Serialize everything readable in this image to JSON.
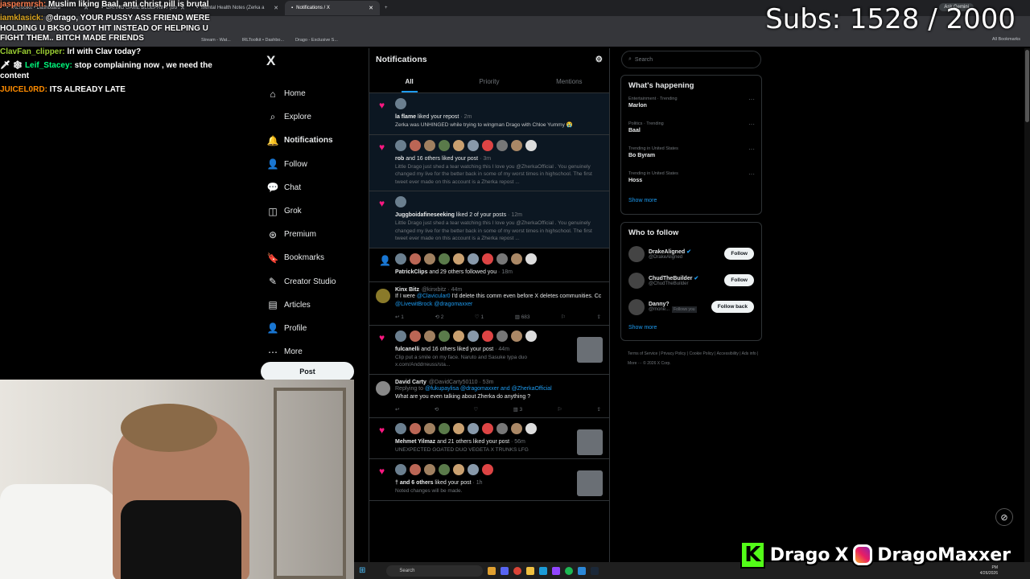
{
  "browser": {
    "tabs": [
      {
        "label": "IRLToolkit • Dashboard",
        "active": false
      },
      {
        "label": "DATING GAME BLUEPRINT (Bo",
        "active": false
      },
      {
        "label": "Mental Health Notes (Zerka a",
        "active": false
      },
      {
        "label": "Notifications / X",
        "active": true
      }
    ],
    "new_tab": "+",
    "bookmarks": [
      "Stream - Wat...",
      "IRLToolkit • Dashbo...",
      "Drago - Exclusive S..."
    ],
    "all_bookmarks": "All Bookmarks",
    "ask_gemini": "Ask Gemini"
  },
  "stream": {
    "subs": "Subs: 1528 / 2000",
    "chat": [
      {
        "user": "jaspermrsh:",
        "text": " Muslim liking Baal, anti christ pill is brutal",
        "color": "#ff7f50"
      },
      {
        "user": "iamklasick:",
        "text": " @drago, YOUR PUSSY ASS FRIEND WERE HOLDING U BKSO UGOT HIT INSTEAD OF HELPING U FIGHT THEM.. BITCH MADE FRIENDS",
        "color": "#daa520"
      },
      {
        "user": "ClavFan_clipper:",
        "text": " lrl with Clav today?",
        "color": "#9acd32"
      },
      {
        "user": "Leif_Stacey:",
        "text": " stop complaining now , we need the content",
        "color": "#00ff7f",
        "prefix": "🗡 ❄ "
      },
      {
        "user": "JUICEL0RD:",
        "text": " ITS ALREADY LATE",
        "color": "#ff8c00"
      }
    ],
    "brand": {
      "kick": "K",
      "kick_name": "Drago",
      "x_mark": "X",
      "ig_name": "DragoMaxxer"
    }
  },
  "nav": {
    "logo": "X",
    "items": [
      {
        "label": "Home",
        "icon": "⌂",
        "name": "home"
      },
      {
        "label": "Explore",
        "icon": "⌕",
        "name": "explore"
      },
      {
        "label": "Notifications",
        "icon": "🔔",
        "name": "notifications",
        "bold": true
      },
      {
        "label": "Follow",
        "icon": "👤",
        "name": "follow"
      },
      {
        "label": "Chat",
        "icon": "💬",
        "name": "chat"
      },
      {
        "label": "Grok",
        "icon": "◫",
        "name": "grok"
      },
      {
        "label": "Premium",
        "icon": "⊛",
        "name": "premium"
      },
      {
        "label": "Bookmarks",
        "icon": "🔖",
        "name": "bookmarks"
      },
      {
        "label": "Creator Studio",
        "icon": "✎",
        "name": "creator-studio"
      },
      {
        "label": "Articles",
        "icon": "▤",
        "name": "articles"
      },
      {
        "label": "Profile",
        "icon": "👤",
        "name": "profile"
      },
      {
        "label": "More",
        "icon": "⋯",
        "name": "more"
      }
    ],
    "post": "Post"
  },
  "feed": {
    "title": "Notifications",
    "tabs": [
      "All",
      "Priority",
      "Mentions"
    ],
    "notifications": [
      {
        "avatars": 1,
        "who": "la flame",
        "action": " liked your repost",
        "time": " · 2m",
        "text": "Zerka was UNHINGED while trying to wingman Drago with Chloe Yummy 😭",
        "white": true,
        "hl": true
      },
      {
        "avatars": 10,
        "who": "rob",
        "action": " and 16 others liked your post",
        "time": " · 3m",
        "text": "Little Drago just shed a tear watching this I love you @ZherkaOfficial . You genuinely changed my live for the better back in some of my worst times in highschool. The first tweet ever made on this account is a Zherka  repost ...",
        "hl": true
      },
      {
        "avatars": 1,
        "who": "Juggboidafineseeking",
        "action": " liked 2 of your posts",
        "time": " · 12m",
        "text": "Little Drago just shed a tear watching this I love you @ZherkaOfficial . You genuinely changed my live for the better back in some of my worst times in highschool. The first tweet ever made on this account is a Zherka  repost ...",
        "hl": true
      },
      {
        "avatars": 10,
        "who": "PatrickClips",
        "action": " and 29 others followed you",
        "time": " · 18m",
        "text": "",
        "follow": true
      }
    ],
    "tweet1": {
      "name": "Kinx Bitz",
      "handle": "@kinxbitz · 44m",
      "text_a": "If I were ",
      "link1": "@Clavicular0",
      "text_b": " I'd delete this comm even before X deletes communities. Cc ",
      "link2": "@LivewitBrock @dragomaxxer",
      "replies": "1",
      "reposts": "2",
      "likes": "1",
      "views": "683"
    },
    "notif2": [
      {
        "avatars": 10,
        "who": "fulcanelli",
        "action": " and 16 others liked your post",
        "time": " · 44m",
        "text": "Clip put a smile on my face. Naruto and Sasuke typa duo x.com/Anddrreuss/sta...",
        "thumb": true
      },
      {
        "avatars": 0
      }
    ],
    "tweet2": {
      "name": "David Carty",
      "handle": "@DavidCarty50110 · 53m",
      "reply_to": "Replying to ",
      "reply_links": "@fukupaylisa @dragomaxxer and @ZherkaOfficial",
      "text": "What are you even talking about Zherka do anything ?",
      "likes": "3"
    },
    "notif3": [
      {
        "avatars": 10,
        "who": "Mehmet Yilmaz",
        "action": " and 21 others liked your post",
        "time": " · 56m",
        "text": "UNEXPECTED GOATED DUO VEGETA X TRUNKS LFG"
      },
      {
        "avatars": 7,
        "who": "† and 6 others",
        "action": " liked your post",
        "time": " · 1h",
        "text": "Noted changes will be made."
      }
    ]
  },
  "right": {
    "search_placeholder": "Search",
    "happening_title": "What's happening",
    "trends": [
      {
        "meta": "Entertainment · Trending",
        "name": "Marlon"
      },
      {
        "meta": "Politics · Trending",
        "name": "Baal"
      },
      {
        "meta": "Trending in United States",
        "name": "Bo Byram"
      },
      {
        "meta": "Trending in United States",
        "name": "Hoss"
      }
    ],
    "show_more": "Show more",
    "wtf_title": "Who to follow",
    "follow": [
      {
        "name": "DrakeAligned",
        "handle": "@DrakeAligned",
        "btn": "Follow",
        "verified": true
      },
      {
        "name": "ChudTheBuilder",
        "handle": "@ChudTheBuilder",
        "btn": "Follow",
        "verified": true
      },
      {
        "name": "Danny?",
        "handle": "@mone...",
        "btn": "Follow back",
        "badge": "Follows you"
      }
    ],
    "footer": "Terms of Service | Privacy Policy | Cookie Policy | Accessibility | Ads info | More ··· © 2026 X Corp."
  },
  "taskbar": {
    "search": "Search",
    "clock_time": "PM",
    "clock_date": "4/26/2026"
  }
}
